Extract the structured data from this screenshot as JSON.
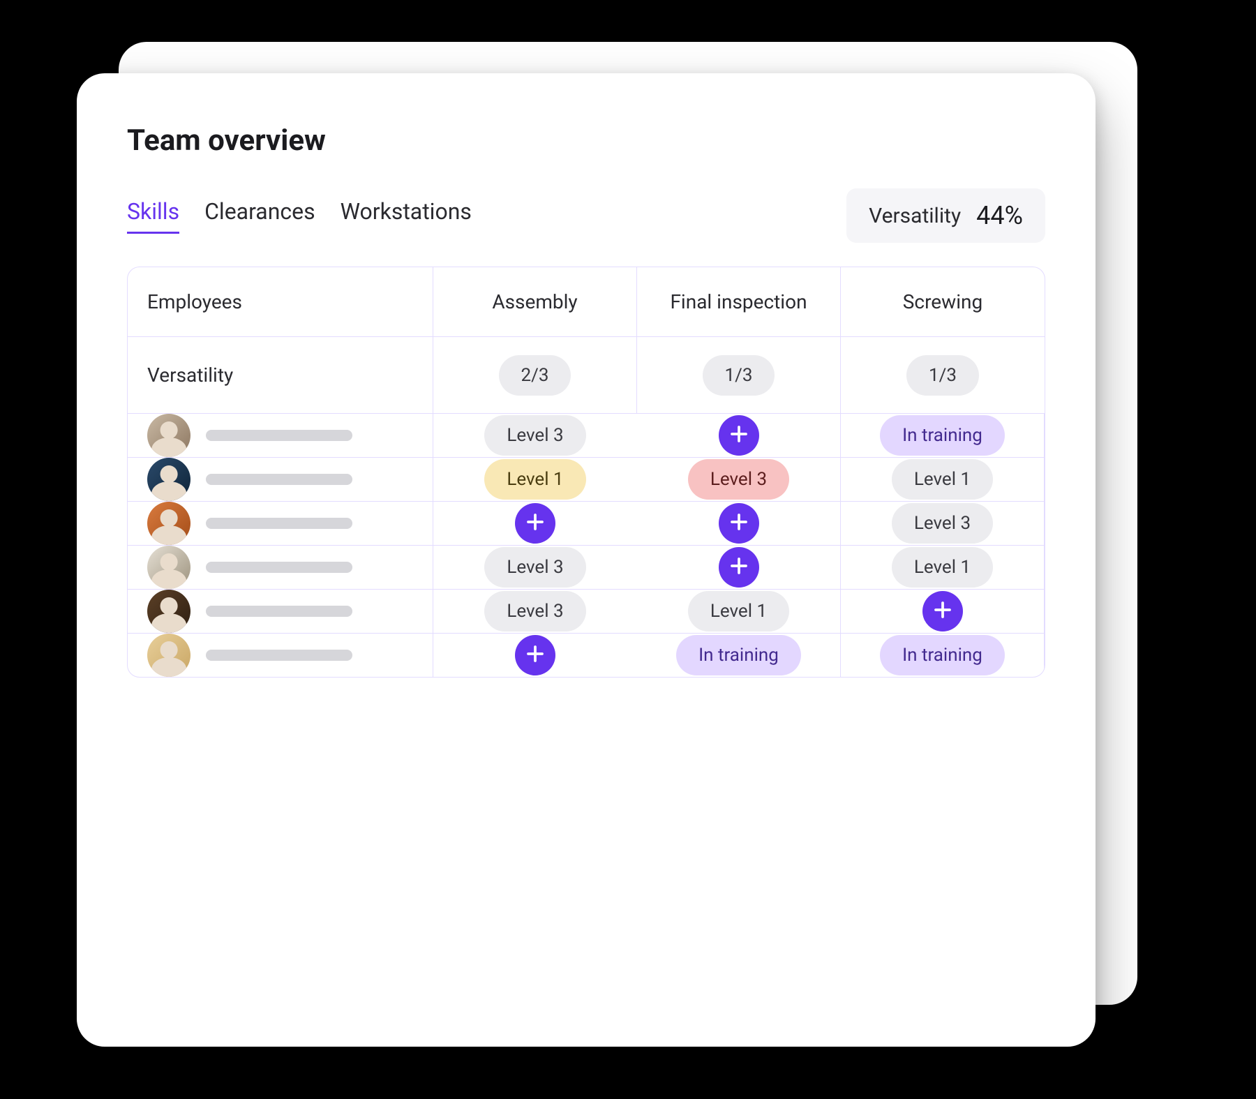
{
  "title": "Team overview",
  "tabs": {
    "skills": "Skills",
    "clearances": "Clearances",
    "workstations": "Workstations"
  },
  "metric": {
    "label": "Versatility",
    "value": "44%"
  },
  "columns": {
    "employees": "Employees",
    "c1": "Assembly",
    "c2": "Final inspection",
    "c3": "Screwing"
  },
  "versatility_row": {
    "label": "Versatility",
    "c1": "2/3",
    "c2": "1/3",
    "c3": "1/3"
  },
  "levels": {
    "level1": "Level 1",
    "level3": "Level 3",
    "in_training": "In training"
  },
  "rows": [
    {
      "c1": {
        "type": "pill",
        "style": "gray",
        "text_key": "levels.level3"
      },
      "c2": {
        "type": "plus"
      },
      "c3": {
        "type": "pill",
        "style": "lilac",
        "text_key": "levels.in_training"
      }
    },
    {
      "c1": {
        "type": "pill",
        "style": "yellow",
        "text_key": "levels.level1"
      },
      "c2": {
        "type": "pill",
        "style": "pink",
        "text_key": "levels.level3"
      },
      "c3": {
        "type": "pill",
        "style": "gray",
        "text_key": "levels.level1"
      }
    },
    {
      "c1": {
        "type": "plus"
      },
      "c2": {
        "type": "plus"
      },
      "c3": {
        "type": "pill",
        "style": "gray",
        "text_key": "levels.level3"
      }
    },
    {
      "c1": {
        "type": "pill",
        "style": "gray",
        "text_key": "levels.level3"
      },
      "c2": {
        "type": "plus"
      },
      "c3": {
        "type": "pill",
        "style": "gray",
        "text_key": "levels.level1"
      }
    },
    {
      "c1": {
        "type": "pill",
        "style": "gray",
        "text_key": "levels.level3"
      },
      "c2": {
        "type": "pill",
        "style": "gray",
        "text_key": "levels.level1"
      },
      "c3": {
        "type": "plus"
      }
    },
    {
      "c1": {
        "type": "plus"
      },
      "c2": {
        "type": "pill",
        "style": "lilac",
        "text_key": "levels.in_training"
      },
      "c3": {
        "type": "pill",
        "style": "lilac",
        "text_key": "levels.in_training"
      }
    }
  ],
  "colors": {
    "accent": "#6633ee"
  }
}
